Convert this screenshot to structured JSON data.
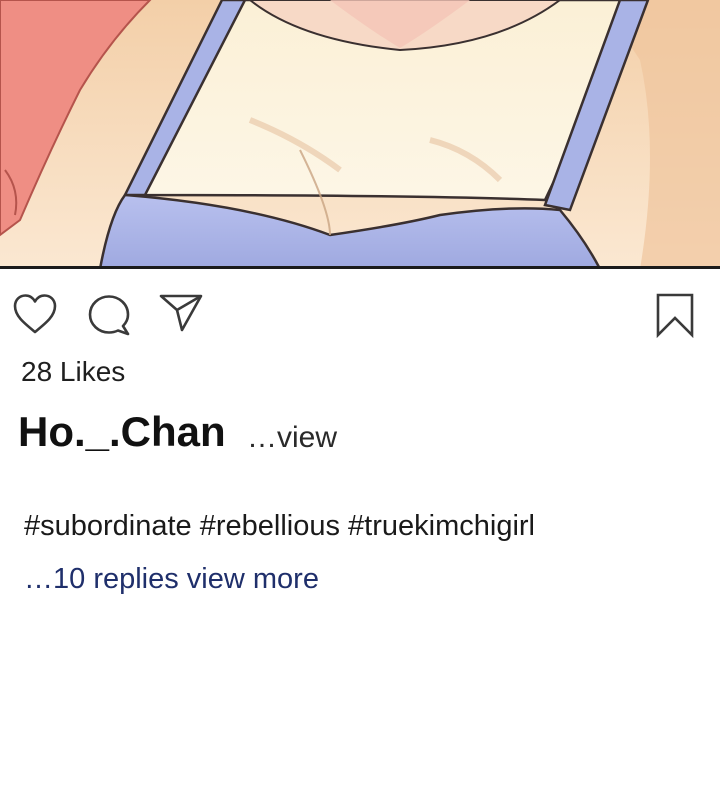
{
  "post": {
    "likes_text": "28 Likes",
    "username": "Ho._.Chan",
    "caption_more": "…view",
    "hashtags": "#subordinate #rebellious #truekimchigirl",
    "replies_link": "…10 replies view more"
  },
  "icons": {
    "like": "heart-icon",
    "comment": "comment-bubble-icon",
    "share": "paper-plane-icon",
    "save": "bookmark-icon"
  },
  "colors": {
    "text": "#1f1f1f",
    "link": "#1f2f6b",
    "illustration_skin": "#f6dcc0",
    "illustration_top": "#a9b3e6",
    "illustration_hair": "#ef8e84"
  }
}
